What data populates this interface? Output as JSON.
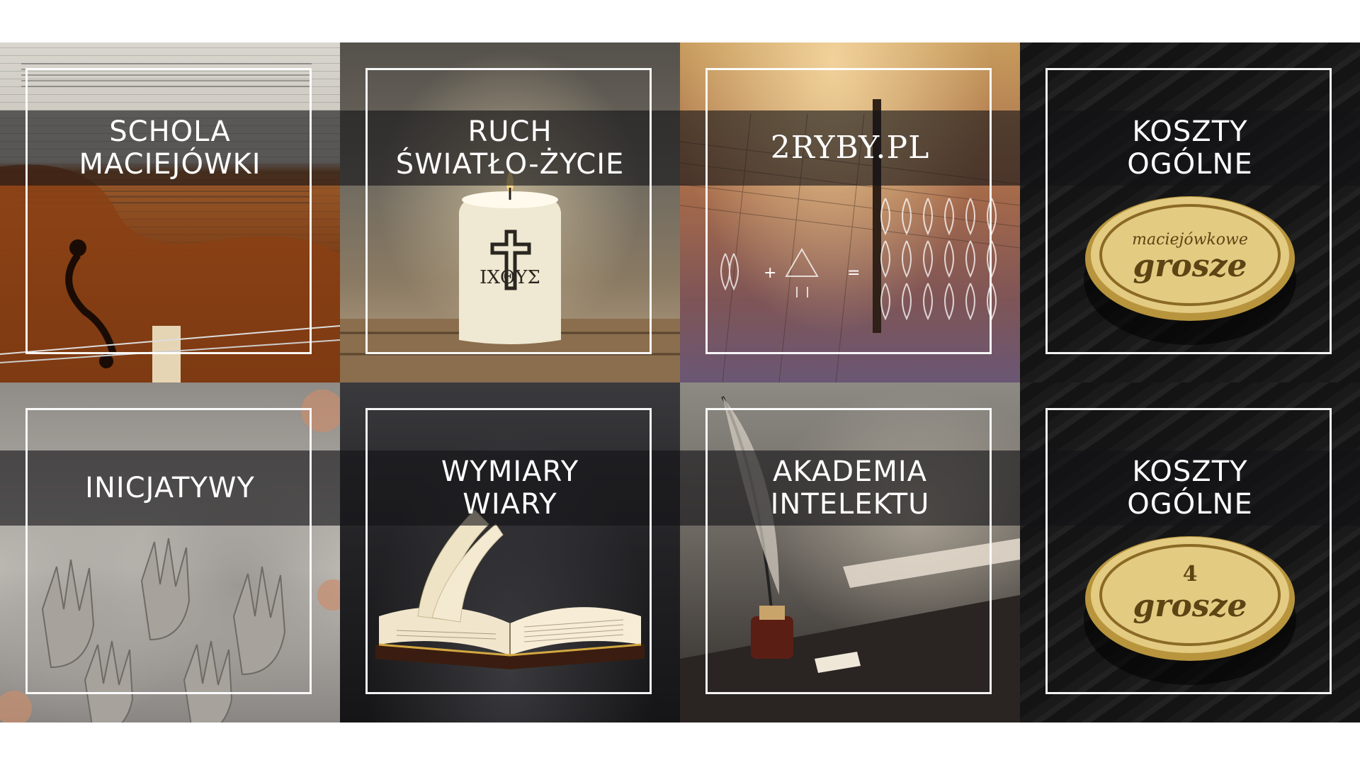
{
  "tiles": [
    {
      "label": "SCHOLA\nMACIEJÓWKI",
      "icon": "violin-icon"
    },
    {
      "label": "RUCH\nŚWIATŁO-ŻYCIE",
      "icon": "candle-icon",
      "candle_symbol": "ΙΧΘΥΣ"
    },
    {
      "label": "2RYBY.PL",
      "icon": "fish-net-icon",
      "equation": {
        "plus": "+",
        "equals": "="
      }
    },
    {
      "label": "KOSZTY\nOGÓLNE",
      "icon": "coin-icon",
      "coin_line1": "maciejówkowe",
      "coin_line2": "grosze"
    },
    {
      "label": "INICJATYWY",
      "icon": "clay-hands-icon"
    },
    {
      "label": "WYMIARY\nWIARY",
      "icon": "open-bible-icon"
    },
    {
      "label": "AKADEMIA\nINTELEKTU",
      "icon": "quill-inkwell-icon"
    },
    {
      "label": "KOSZTY\nOGÓLNE",
      "icon": "coin-icon",
      "coin_line1": "4",
      "coin_line2": "grosze"
    }
  ]
}
